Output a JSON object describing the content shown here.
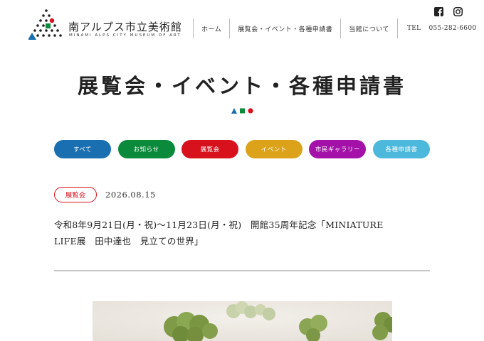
{
  "site": {
    "logo_title": "南アルプス市立美術館",
    "logo_subtitle": "MINAMI ALPS CITY MUSEUM OF ART"
  },
  "nav": {
    "items": [
      "ホーム",
      "展覧会・イベント・各種申請書",
      "当館について"
    ],
    "tel_label": "TEL",
    "tel_number": "055-282-6600"
  },
  "social": [
    "facebook-icon",
    "instagram-icon"
  ],
  "page": {
    "title": "展覧会・イベント・各種申請書"
  },
  "categories": [
    {
      "label": "すべて",
      "color": "#1a6fb0"
    },
    {
      "label": "お知らせ",
      "color": "#0a8a3a"
    },
    {
      "label": "展覧会",
      "color": "#d7121d"
    },
    {
      "label": "イベント",
      "color": "#dba21a"
    },
    {
      "label": "市民ギャラリー",
      "color": "#a411a8"
    },
    {
      "label": "各種申請書",
      "color": "#4bb8dc"
    }
  ],
  "post": {
    "tag": "展覧会",
    "date": "2026.08.15",
    "title_line1": "令和8年9月21日(月・祝)〜11月23日(月・祝)　開館35周年記念「MINIATURE",
    "title_line2": "LIFE展　田中達也　見立ての世界」"
  },
  "colors": {
    "blue": "#1a6fb0",
    "green": "#0a8a3a",
    "red": "#d7121d"
  }
}
